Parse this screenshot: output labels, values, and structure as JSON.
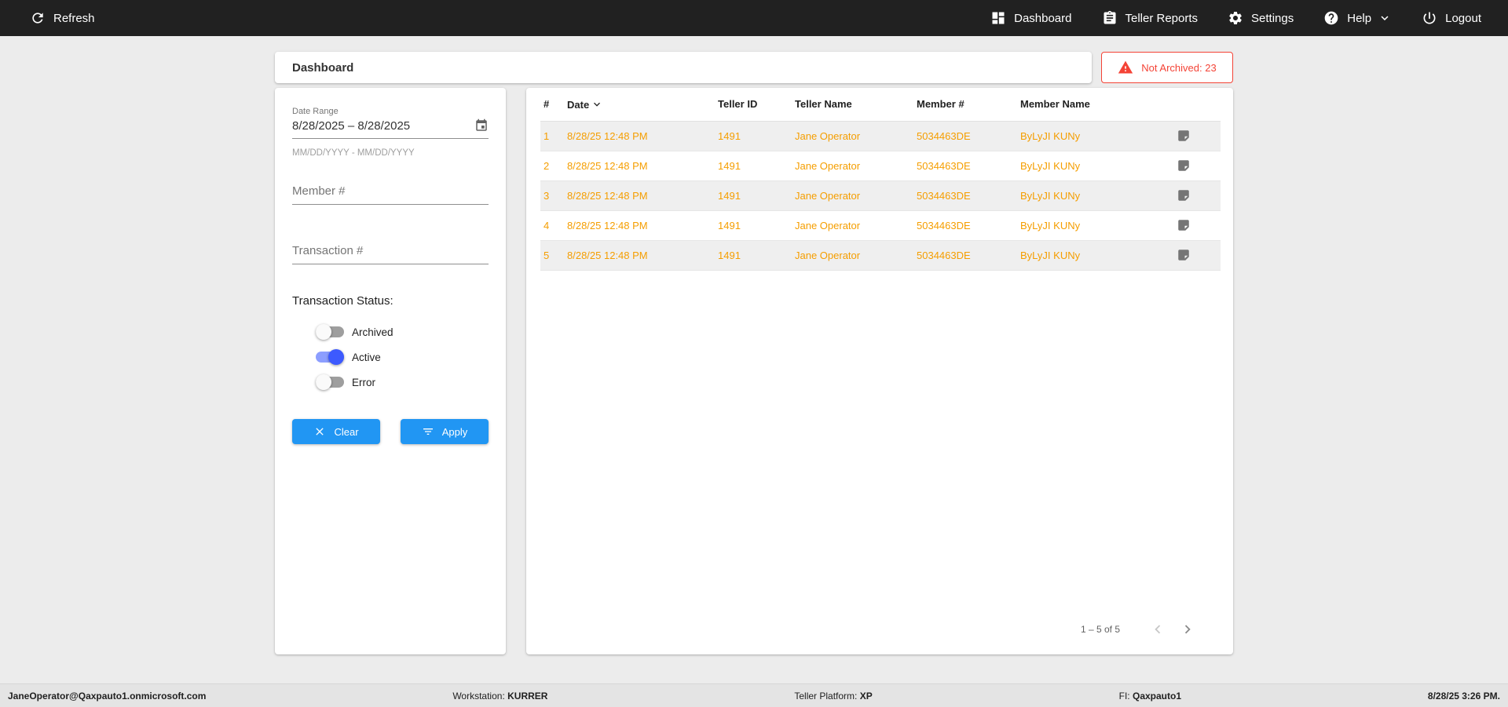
{
  "colors": {
    "topbar-bg": "#212121",
    "page-bg": "#ececec",
    "footer-bg": "#e4e4e4",
    "accent-blue": "#2196f3",
    "toggle-on-thumb": "#3d5afe",
    "toggle-on-track": "#8c9eff",
    "row-orange": "#f59e00",
    "alert-red": "#f44336",
    "muted-gray": "#757575"
  },
  "icons": {
    "refresh": "refresh-icon",
    "dashboard": "dashboard-grid-icon",
    "teller_reports": "clipboard-icon",
    "settings": "gear-icon",
    "help": "question-circle-icon",
    "help_chevron": "chevron-down-icon",
    "logout": "power-icon",
    "date_range": "calendar-icon",
    "not_archived": "warning-triangle-icon",
    "date_sort": "sort-desc-chevron-icon",
    "row_note": "note-icon",
    "clear": "close-x-icon",
    "apply": "filter-lines-icon",
    "page_prev": "chevron-left-icon",
    "page_next": "chevron-right-icon"
  },
  "topbar": {
    "refresh": "Refresh",
    "dashboard": "Dashboard",
    "teller_reports": "Teller Reports",
    "settings": "Settings",
    "help": "Help",
    "logout": "Logout"
  },
  "header": {
    "title": "Dashboard",
    "not_archived": "Not Archived: 23"
  },
  "filters": {
    "date_range_label": "Date Range",
    "date_range_value": "8/28/2025 – 8/28/2025",
    "date_range_hint": "MM/DD/YYYY - MM/DD/YYYY",
    "member_placeholder": "Member #",
    "transaction_placeholder": "Transaction #",
    "status_label": "Transaction Status:",
    "toggles": [
      {
        "label": "Archived",
        "on": false
      },
      {
        "label": "Active",
        "on": true
      },
      {
        "label": "Error",
        "on": false
      }
    ],
    "clear": "Clear",
    "apply": "Apply"
  },
  "table": {
    "columns": [
      "#",
      "Date",
      "Teller ID",
      "Teller Name",
      "Member #",
      "Member Name"
    ],
    "rows": [
      {
        "num": "1",
        "date": "8/28/25 12:48 PM",
        "teller_id": "1491",
        "teller_name": "Jane Operator",
        "member_number": "5034463DE",
        "member_name": "ByLyJI KUNy"
      },
      {
        "num": "2",
        "date": "8/28/25 12:48 PM",
        "teller_id": "1491",
        "teller_name": "Jane Operator",
        "member_number": "5034463DE",
        "member_name": "ByLyJI KUNy"
      },
      {
        "num": "3",
        "date": "8/28/25 12:48 PM",
        "teller_id": "1491",
        "teller_name": "Jane Operator",
        "member_number": "5034463DE",
        "member_name": "ByLyJI KUNy"
      },
      {
        "num": "4",
        "date": "8/28/25 12:48 PM",
        "teller_id": "1491",
        "teller_name": "Jane Operator",
        "member_number": "5034463DE",
        "member_name": "ByLyJI KUNy"
      },
      {
        "num": "5",
        "date": "8/28/25 12:48 PM",
        "teller_id": "1491",
        "teller_name": "Jane Operator",
        "member_number": "5034463DE",
        "member_name": "ByLyJI KUNy"
      }
    ],
    "pagination": "1 – 5 of 5"
  },
  "statusbar": {
    "user": "JaneOperator@Qaxpauto1.onmicrosoft.com",
    "workstation_label": "Workstation:",
    "workstation": "KURRER",
    "platform_label": "Teller Platform:",
    "platform": "XP",
    "fi_label": "FI:",
    "fi": "Qaxpauto1",
    "datetime": "8/28/25 3:26 PM."
  }
}
